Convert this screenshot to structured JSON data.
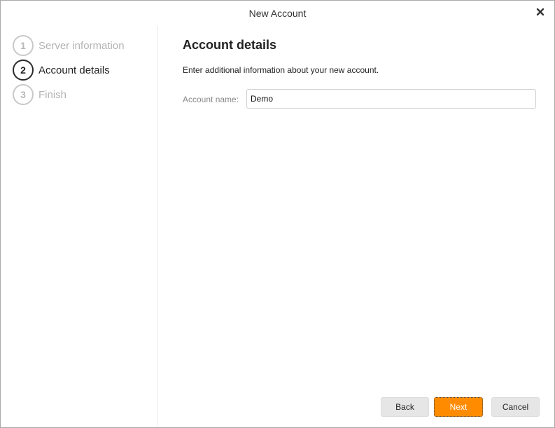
{
  "window": {
    "title": "New Account",
    "close_icon": "close-icon"
  },
  "steps": [
    {
      "number": "1",
      "label": "Server information",
      "state": "done"
    },
    {
      "number": "2",
      "label": "Account details",
      "state": "active"
    },
    {
      "number": "3",
      "label": "Finish",
      "state": "pending"
    }
  ],
  "content": {
    "heading": "Account details",
    "description": "Enter additional information about your new account.",
    "account_name_label": "Account name:",
    "account_name_value": "Demo"
  },
  "buttons": {
    "back": "Back",
    "next": "Next",
    "cancel": "Cancel"
  },
  "colors": {
    "accent": "#ff8c00",
    "active_step": "#1f1f1f",
    "inactive_step": "#b3b3b3"
  }
}
